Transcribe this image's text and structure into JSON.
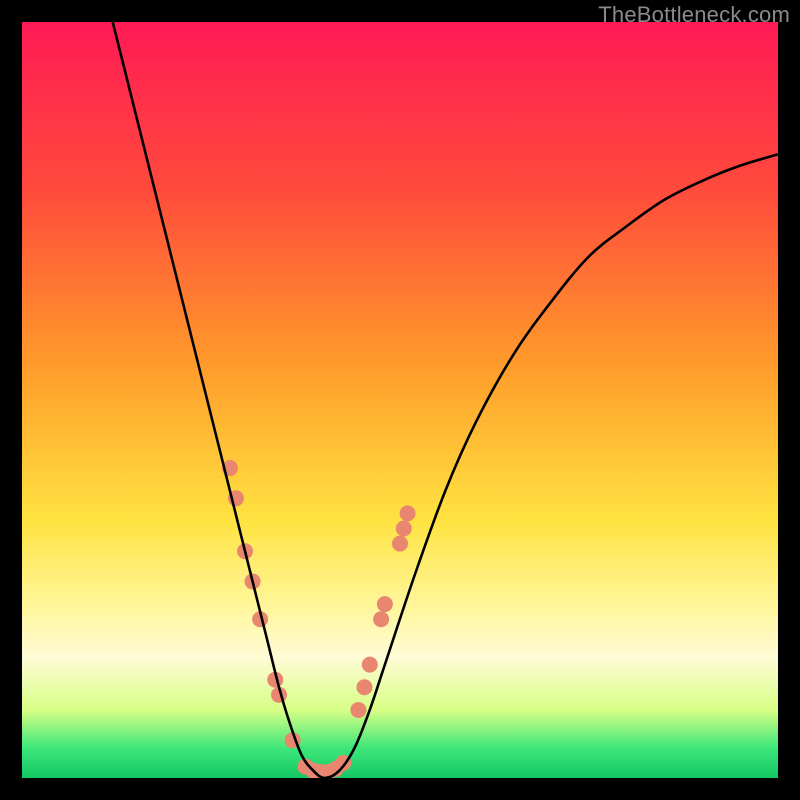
{
  "watermark": "TheBottleneck.com",
  "chart_data": {
    "type": "line",
    "title": "",
    "xlabel": "",
    "ylabel": "",
    "xlim": [
      0,
      100
    ],
    "ylim": [
      0,
      100
    ],
    "gradient_stops": [
      {
        "offset": 0,
        "color": "#ff1a55"
      },
      {
        "offset": 22,
        "color": "#ff4a3c"
      },
      {
        "offset": 45,
        "color": "#ff9a2a"
      },
      {
        "offset": 66,
        "color": "#ffe341"
      },
      {
        "offset": 78,
        "color": "#fff7a0"
      },
      {
        "offset": 84,
        "color": "#fffbd6"
      },
      {
        "offset": 91,
        "color": "#d8ff86"
      },
      {
        "offset": 96,
        "color": "#3fe77a"
      },
      {
        "offset": 100,
        "color": "#14c765"
      }
    ],
    "series": [
      {
        "name": "bottleneck-curve",
        "color": "#000000",
        "x": [
          12,
          14,
          16,
          18,
          20,
          22,
          24,
          26,
          28,
          29.5,
          31,
          32.5,
          34,
          35.5,
          37,
          38.5,
          40,
          42,
          44,
          46,
          48,
          52,
          56,
          60,
          65,
          70,
          75,
          80,
          85,
          90,
          95,
          100
        ],
        "y": [
          100,
          92,
          84,
          76,
          68,
          60,
          52,
          44,
          36,
          30,
          24,
          18,
          12,
          7,
          3,
          1,
          0,
          1,
          4,
          9,
          15,
          27,
          38,
          47,
          56,
          63,
          69,
          73,
          76.5,
          79,
          81,
          82.5
        ]
      }
    ],
    "markers": {
      "color": "#e9866f",
      "radius": 8,
      "points": [
        {
          "x": 27.5,
          "y": 41
        },
        {
          "x": 28.3,
          "y": 37
        },
        {
          "x": 29.5,
          "y": 30
        },
        {
          "x": 30.5,
          "y": 26
        },
        {
          "x": 31.5,
          "y": 21
        },
        {
          "x": 33.5,
          "y": 13
        },
        {
          "x": 34.0,
          "y": 11
        },
        {
          "x": 35.8,
          "y": 5
        },
        {
          "x": 37.5,
          "y": 1.5
        },
        {
          "x": 38.5,
          "y": 1
        },
        {
          "x": 39.5,
          "y": 0.8
        },
        {
          "x": 40.5,
          "y": 0.8
        },
        {
          "x": 41.5,
          "y": 1.2
        },
        {
          "x": 42.5,
          "y": 2
        },
        {
          "x": 44.5,
          "y": 9
        },
        {
          "x": 45.3,
          "y": 12
        },
        {
          "x": 46.0,
          "y": 15
        },
        {
          "x": 47.5,
          "y": 21
        },
        {
          "x": 48.0,
          "y": 23
        },
        {
          "x": 50.0,
          "y": 31
        },
        {
          "x": 50.5,
          "y": 33
        },
        {
          "x": 51.0,
          "y": 35
        }
      ]
    }
  }
}
